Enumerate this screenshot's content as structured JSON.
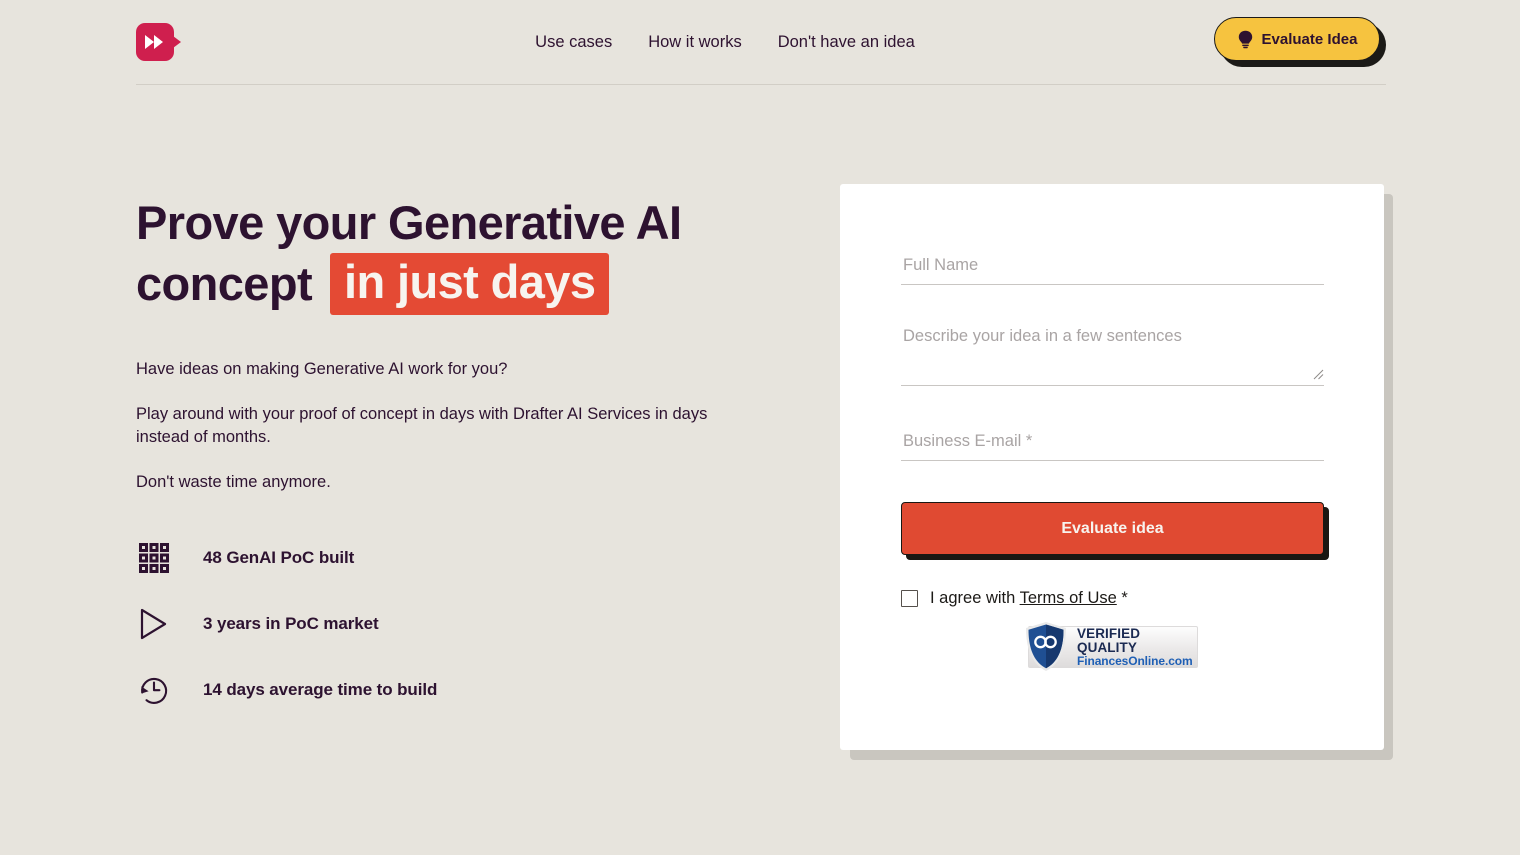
{
  "theme": {
    "background": "#e7e4dd",
    "ink": "#2d1230",
    "accent_red": "#e04a32",
    "accent_yellow": "#f6c33f",
    "logo_pink": "#cf1f4e",
    "card_bg": "#ffffff"
  },
  "header": {
    "logo_name": "drafter-ai-logo",
    "nav": [
      {
        "label": "Use cases",
        "name": "nav-use-cases"
      },
      {
        "label": "How it works",
        "name": "nav-how-it-works"
      },
      {
        "label": "Don't have an idea",
        "name": "nav-dont-have-an-idea"
      }
    ],
    "cta": {
      "label": "Evaluate Idea",
      "icon": "lightbulb-icon"
    }
  },
  "hero": {
    "headline_line1": "Prove your Generative AI",
    "headline_line2_plain": "concept",
    "headline_line2_highlight": "in just days",
    "paragraphs": [
      "Have ideas on making Generative AI work for you?",
      "Play around with your proof of concept in days with Drafter AI Services in days instead of months.",
      "Don't waste time anymore."
    ],
    "stats": [
      {
        "icon": "grid-icon",
        "label": "48 GenAI PoC built"
      },
      {
        "icon": "play-triangle-icon",
        "label": "3 years in PoC market"
      },
      {
        "icon": "clock-history-icon",
        "label": "14 days average time to build"
      }
    ]
  },
  "form": {
    "full_name": {
      "placeholder": "Full Name",
      "value": ""
    },
    "idea": {
      "placeholder": "Describe your idea in a few sentences",
      "value": ""
    },
    "email": {
      "placeholder": "Business E-mail *",
      "value": ""
    },
    "submit_label": "Evaluate idea",
    "agree_prefix": "I agree with ",
    "agree_link": "Terms of Use",
    "agree_suffix": " *",
    "checkbox_checked": false
  },
  "badge": {
    "icon": "verified-shield-icon",
    "line1": "VERIFIED QUALITY",
    "line2": "FinancesOnline.com"
  }
}
